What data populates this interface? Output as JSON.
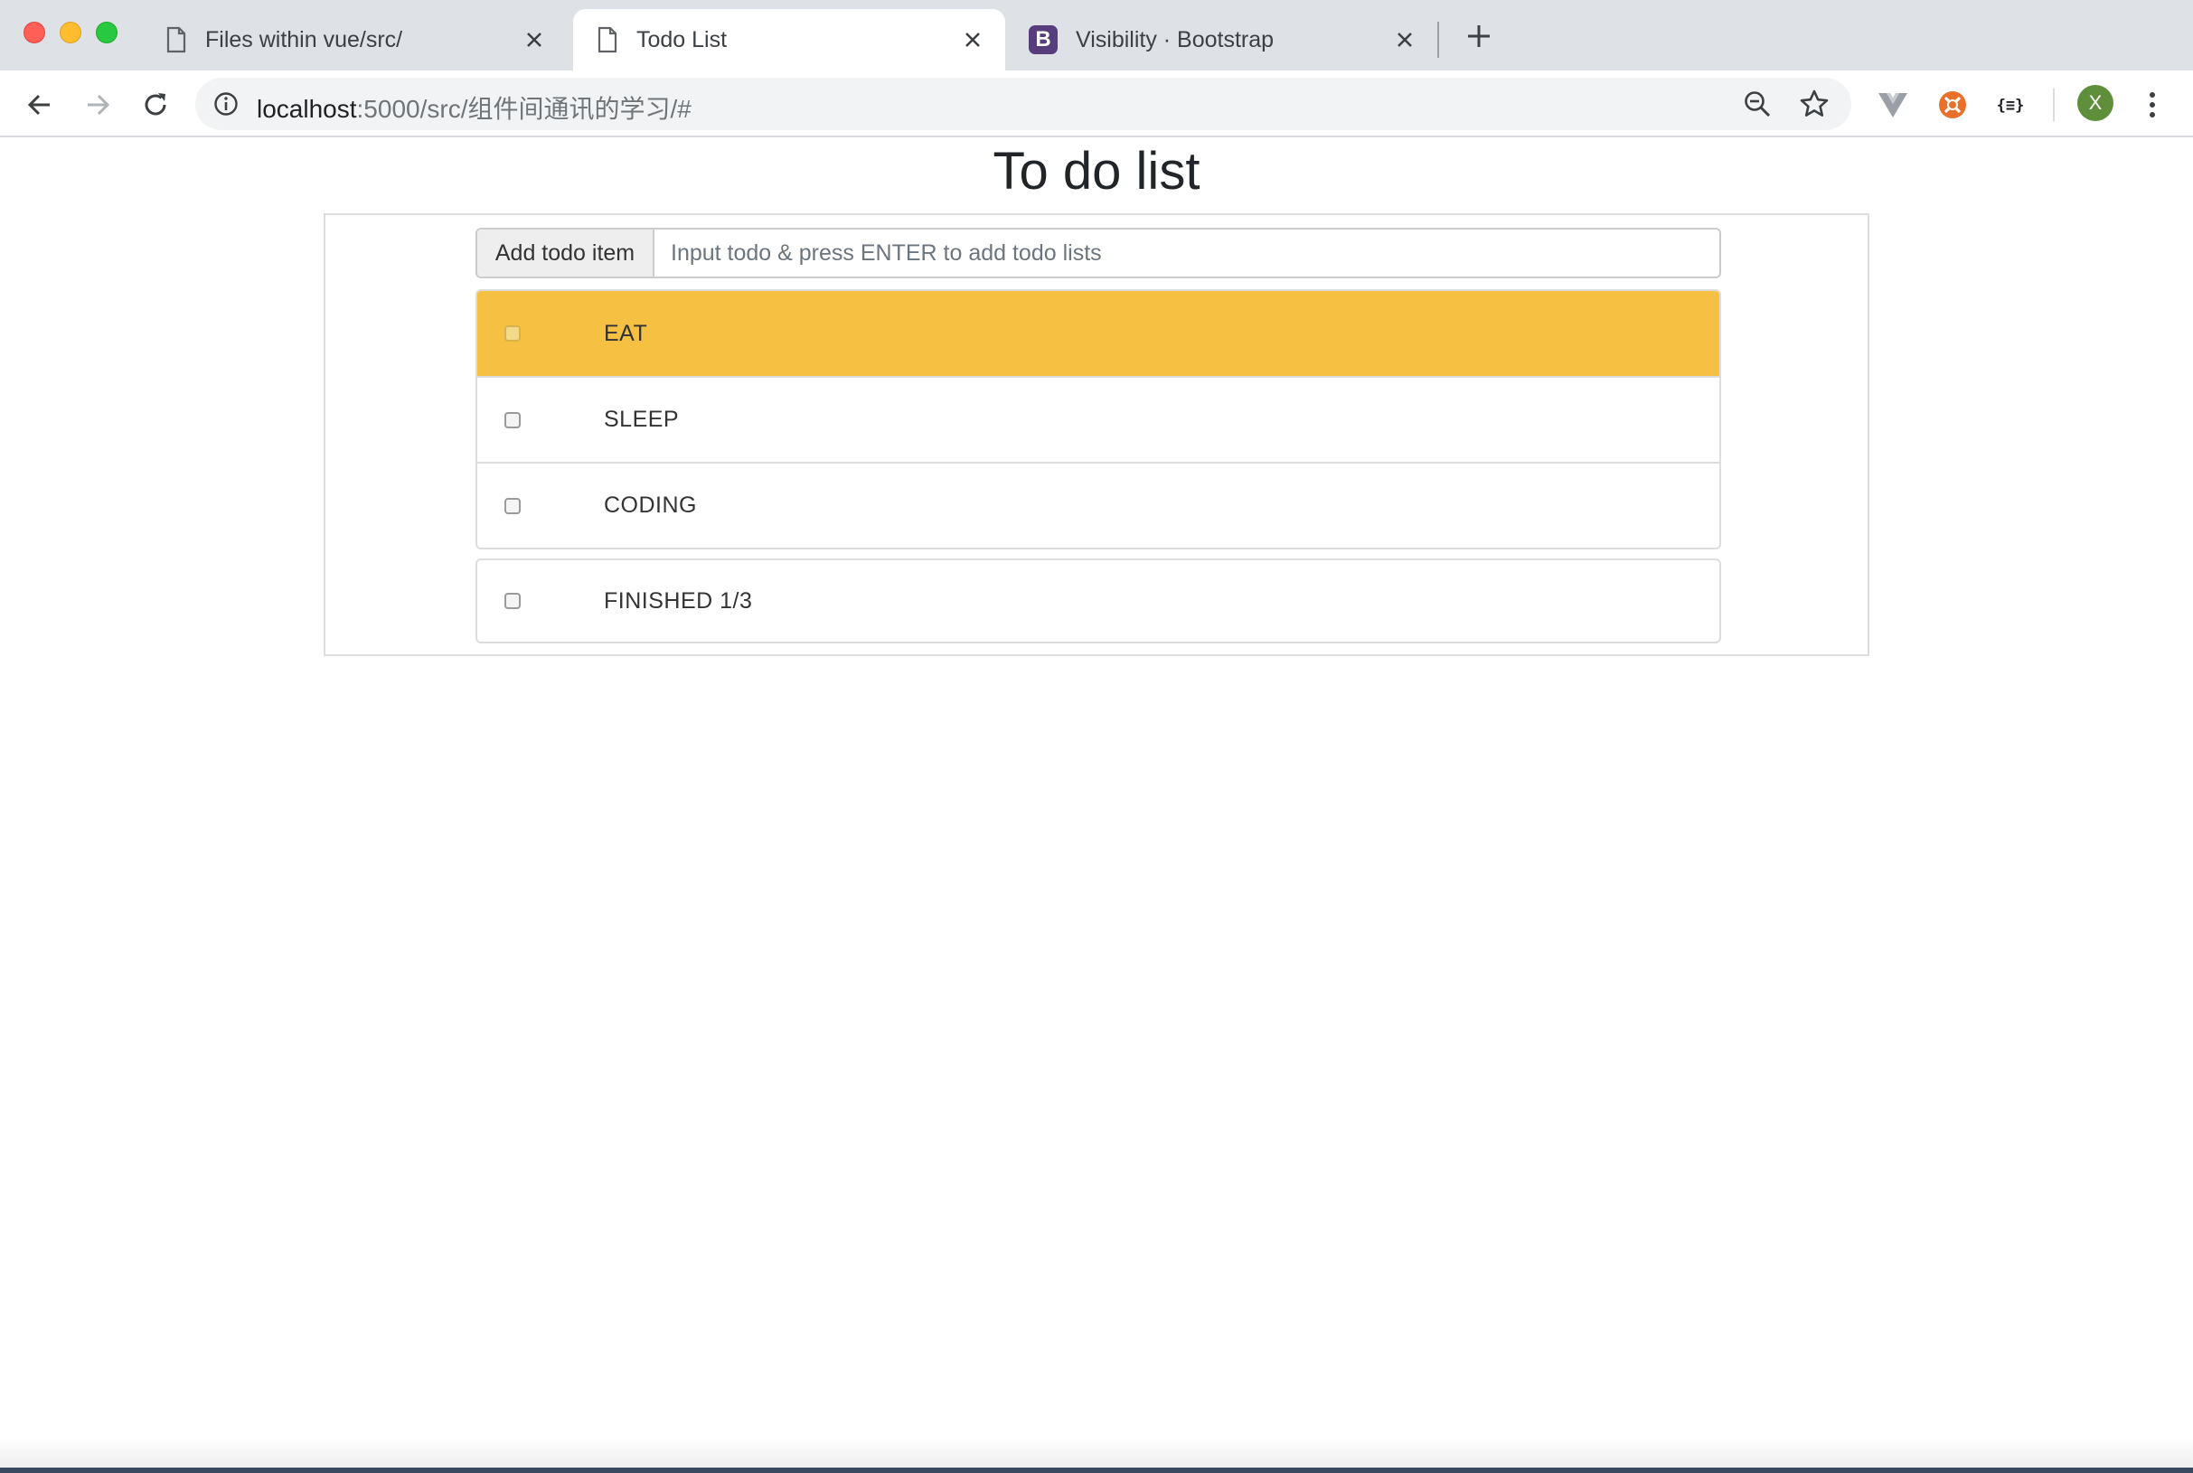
{
  "browser": {
    "tabs": [
      {
        "title": "Files within vue/src/",
        "active": false,
        "icon": "file-icon"
      },
      {
        "title": "Todo List",
        "active": true,
        "icon": "file-icon"
      },
      {
        "title": "Visibility · Bootstrap",
        "active": false,
        "icon": "bootstrap-icon",
        "icon_letter": "B"
      }
    ],
    "address": {
      "host": "localhost",
      "path": ":5000/src/组件间通讯的学习/#"
    },
    "profile_initial": "X",
    "extensions": [
      "vue-devtools-icon",
      "orange-extension-icon",
      "json-formatter-icon"
    ]
  },
  "page": {
    "title": "To do list",
    "add_label": "Add todo item",
    "input_placeholder": "Input todo & press ENTER to add todo lists",
    "input_value": "",
    "items": [
      {
        "text": "EAT",
        "checked": false,
        "highlighted": true
      },
      {
        "text": "SLEEP",
        "checked": false,
        "highlighted": false
      },
      {
        "text": "CODING",
        "checked": false,
        "highlighted": false
      }
    ],
    "footer": {
      "text": "FINISHED 1/3",
      "checked": false
    }
  },
  "colors": {
    "highlight": "#f6c142",
    "bootstrap_purple": "#563d7c",
    "avatar_green": "#5f8f3a"
  }
}
